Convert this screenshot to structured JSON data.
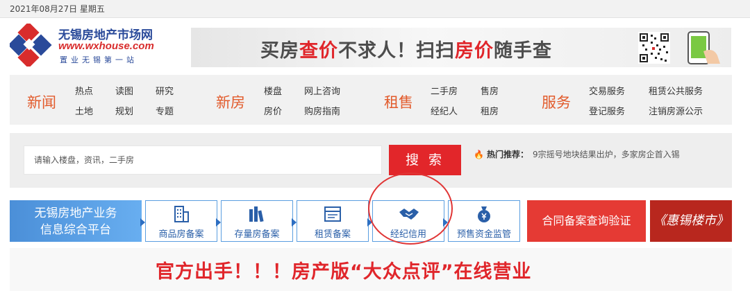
{
  "date": "2021年08月27日 星期五",
  "logo": {
    "name": "无锡房地产市场网",
    "url_text": "www.wxhouse.com",
    "slogan": "置业无锡第一站"
  },
  "banner": {
    "part1": "买房",
    "part2": "查价",
    "part3": "不求人！扫扫",
    "part4": "房价",
    "part5": "随手查"
  },
  "nav": {
    "news": {
      "title": "新闻",
      "links": [
        "热点",
        "读图",
        "研究",
        "土地",
        "规划",
        "专题"
      ]
    },
    "new_home": {
      "title": "新房",
      "links": [
        "楼盘",
        "网上咨询",
        "房价",
        "购房指南"
      ]
    },
    "rent_sale": {
      "title": "租售",
      "links": [
        "二手房",
        "售房",
        "经纪人",
        "租房"
      ]
    },
    "service": {
      "title": "服务",
      "links": [
        "交易服务",
        "租赁公共服务",
        "登记服务",
        "注销房源公示"
      ]
    }
  },
  "search": {
    "placeholder": "请输入楼盘，资讯，二手房",
    "button_label": "搜 索",
    "hot_label": "热门推荐：",
    "hot_text": "9宗摇号地块结果出炉，多家房企首入锡"
  },
  "services": {
    "platform_line1": "无锡房地产业务",
    "platform_line2": "信息综合平台",
    "items": [
      {
        "label": "商品房备案",
        "icon": "building-icon"
      },
      {
        "label": "存量房备案",
        "icon": "books-icon"
      },
      {
        "label": "租赁备案",
        "icon": "window-icon"
      },
      {
        "label": "经纪信用",
        "icon": "handshake-icon"
      },
      {
        "label": "预售资金监管",
        "icon": "money-bag-icon"
      }
    ],
    "verify_label": "合同备案查询验证",
    "brand_label": "《惠锡楼市》"
  },
  "headline": "官方出手！！！房产版“大众点评”在线营业",
  "colors": {
    "accent_red": "#e2262a",
    "nav_orange": "#e25b2c",
    "service_blue": "#2a5fa8"
  }
}
